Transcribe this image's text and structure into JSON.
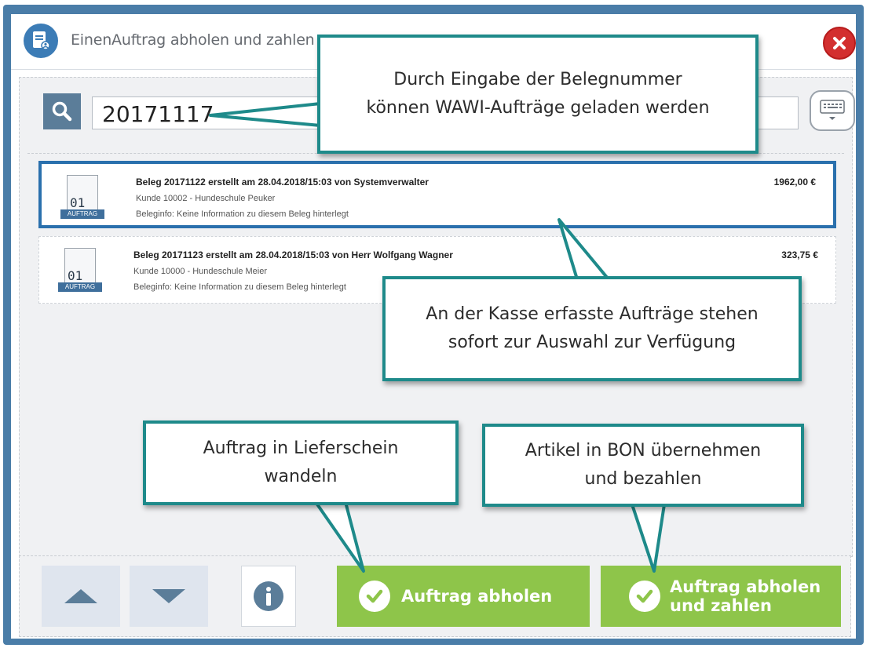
{
  "window": {
    "title": "EinenAuftrag abholen und zahlen"
  },
  "search": {
    "value": "20171117",
    "placeholder": ""
  },
  "orders": [
    {
      "doc_number": "01",
      "doc_tag": "AUFTRAG",
      "title": "Beleg 20171122 erstellt am 28.04.2018/15:03 von Systemverwalter",
      "customer": "Kunde 10002 - Hundeschule Peuker",
      "info": "Beleginfo: Keine Information zu diesem Beleg hinterlegt",
      "price": "1962,00 €",
      "selected": true
    },
    {
      "doc_number": "01",
      "doc_tag": "AUFTRAG",
      "title": "Beleg 20171123 erstellt am 28.04.2018/15:03 von Herr Wolfgang Wagner",
      "customer": "Kunde 10000 - Hundeschule Meier",
      "info": "Beleginfo: Keine Information zu diesem Beleg hinterlegt",
      "price": "323,75 €",
      "selected": false
    }
  ],
  "buttons": {
    "pickup_label": "Auftrag abholen",
    "pickup_pay_line1": "Auftrag abholen",
    "pickup_pay_line2": "und zahlen"
  },
  "callouts": {
    "search_hint": {
      "line1": "Durch Eingabe der Belegnummer",
      "line2": "können WAWI-Aufträge geladen werden"
    },
    "list_hint": {
      "line1": "An der Kasse erfasste Aufträge stehen",
      "line2": "sofort zur Auswahl zur Verfügung"
    },
    "pickup_hint": {
      "line1": "Auftrag in Lieferschein",
      "line2": "wandeln"
    },
    "pay_hint": {
      "line1": "Artikel in BON übernehmen",
      "line2": "und bezahlen"
    }
  },
  "icons": {
    "app": "document-user-icon",
    "close": "close-icon",
    "search": "search-icon",
    "keyboard": "keyboard-icon",
    "up": "arrow-up-icon",
    "down": "arrow-down-icon",
    "info": "info-icon",
    "check": "check-icon"
  },
  "colors": {
    "frame": "#4a7da8",
    "selection": "#2a70ad",
    "action": "#8ec54a",
    "callout_border": "#1e8a8a",
    "close": "#d32f2f"
  }
}
